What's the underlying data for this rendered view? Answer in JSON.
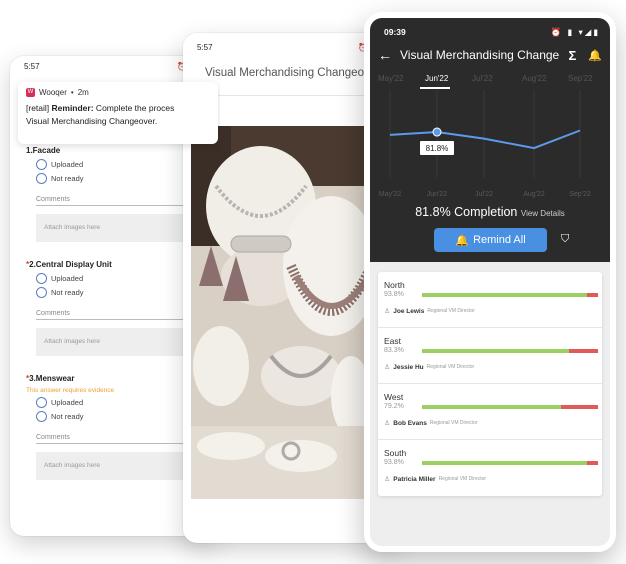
{
  "phone1": {
    "time": "5:57",
    "status_icons": "⏰ ▯ ▾",
    "notification": {
      "app": "Wooqer",
      "age": "2m",
      "prefix": "[retail] ",
      "bold": "Reminder:",
      "text": " Complete the proces",
      "line2": "Visual Merchandising Changeover."
    },
    "sections": [
      {
        "title": "1.Facade",
        "required": false,
        "hint": "",
        "options": [
          "Uploaded",
          "Not ready"
        ],
        "comments": "Comments",
        "attach": "Attach images here"
      },
      {
        "title": "2.Central Display Unit",
        "required": true,
        "hint": "",
        "options": [
          "Uploaded",
          "Not ready"
        ],
        "comments": "Comments",
        "attach": "Attach images here"
      },
      {
        "title": "3.Menswear",
        "required": true,
        "hint": "This answer requires evidence",
        "options": [
          "Uploaded",
          "Not ready"
        ],
        "comments": "Comments",
        "attach": "Attach images here"
      }
    ]
  },
  "phone2": {
    "time": "5:57",
    "status_icons": "⏰ ▯ ▾",
    "title": "Visual Merchandising Changeo"
  },
  "phone3": {
    "time": "09:39",
    "status_icons": "⏰ ▮ ▾◢▮",
    "title": "Visual Merchandising Change",
    "sigma": "Σ",
    "months_top": [
      "May'22",
      "Jun'22",
      "Jul'22",
      "Aug'22",
      "Sep'22"
    ],
    "months_bottom": [
      "May'22",
      "Jun'22",
      "Jul'22",
      "Aug'22",
      "Sep'22"
    ],
    "tooltip": "81.8%",
    "completion": "81.8% Completion",
    "view_details": "View Details",
    "remind": "Remind All",
    "regions": [
      {
        "name": "North",
        "pct": "93.8%",
        "value": 0.938,
        "person": "Joe Lewis",
        "role": "Regional VM Director"
      },
      {
        "name": "East",
        "pct": "83.3%",
        "value": 0.833,
        "person": "Jessie Hu",
        "role": "Regional VM Director"
      },
      {
        "name": "West",
        "pct": "79.2%",
        "value": 0.792,
        "person": "Bob Evans",
        "role": "Regional VM Director"
      },
      {
        "name": "South",
        "pct": "93.8%",
        "value": 0.938,
        "person": "Patricia Miller",
        "role": "Regional VM Director"
      }
    ],
    "colors": {
      "accent": "#4a90e2",
      "good": "#9ccf62",
      "bad": "#e05a5a",
      "dark": "#2b2b2b"
    }
  },
  "chart_data": {
    "type": "line",
    "categories": [
      "May'22",
      "Jun'22",
      "Jul'22",
      "Aug'22",
      "Sep'22"
    ],
    "series": [
      {
        "values": [
          80.5,
          81.8,
          78.8,
          74.5,
          82.5
        ]
      }
    ],
    "highlight": {
      "category": "Jun'22",
      "label": "81.8%"
    },
    "ylim": [
      60,
      100
    ],
    "grid": "vertical"
  }
}
